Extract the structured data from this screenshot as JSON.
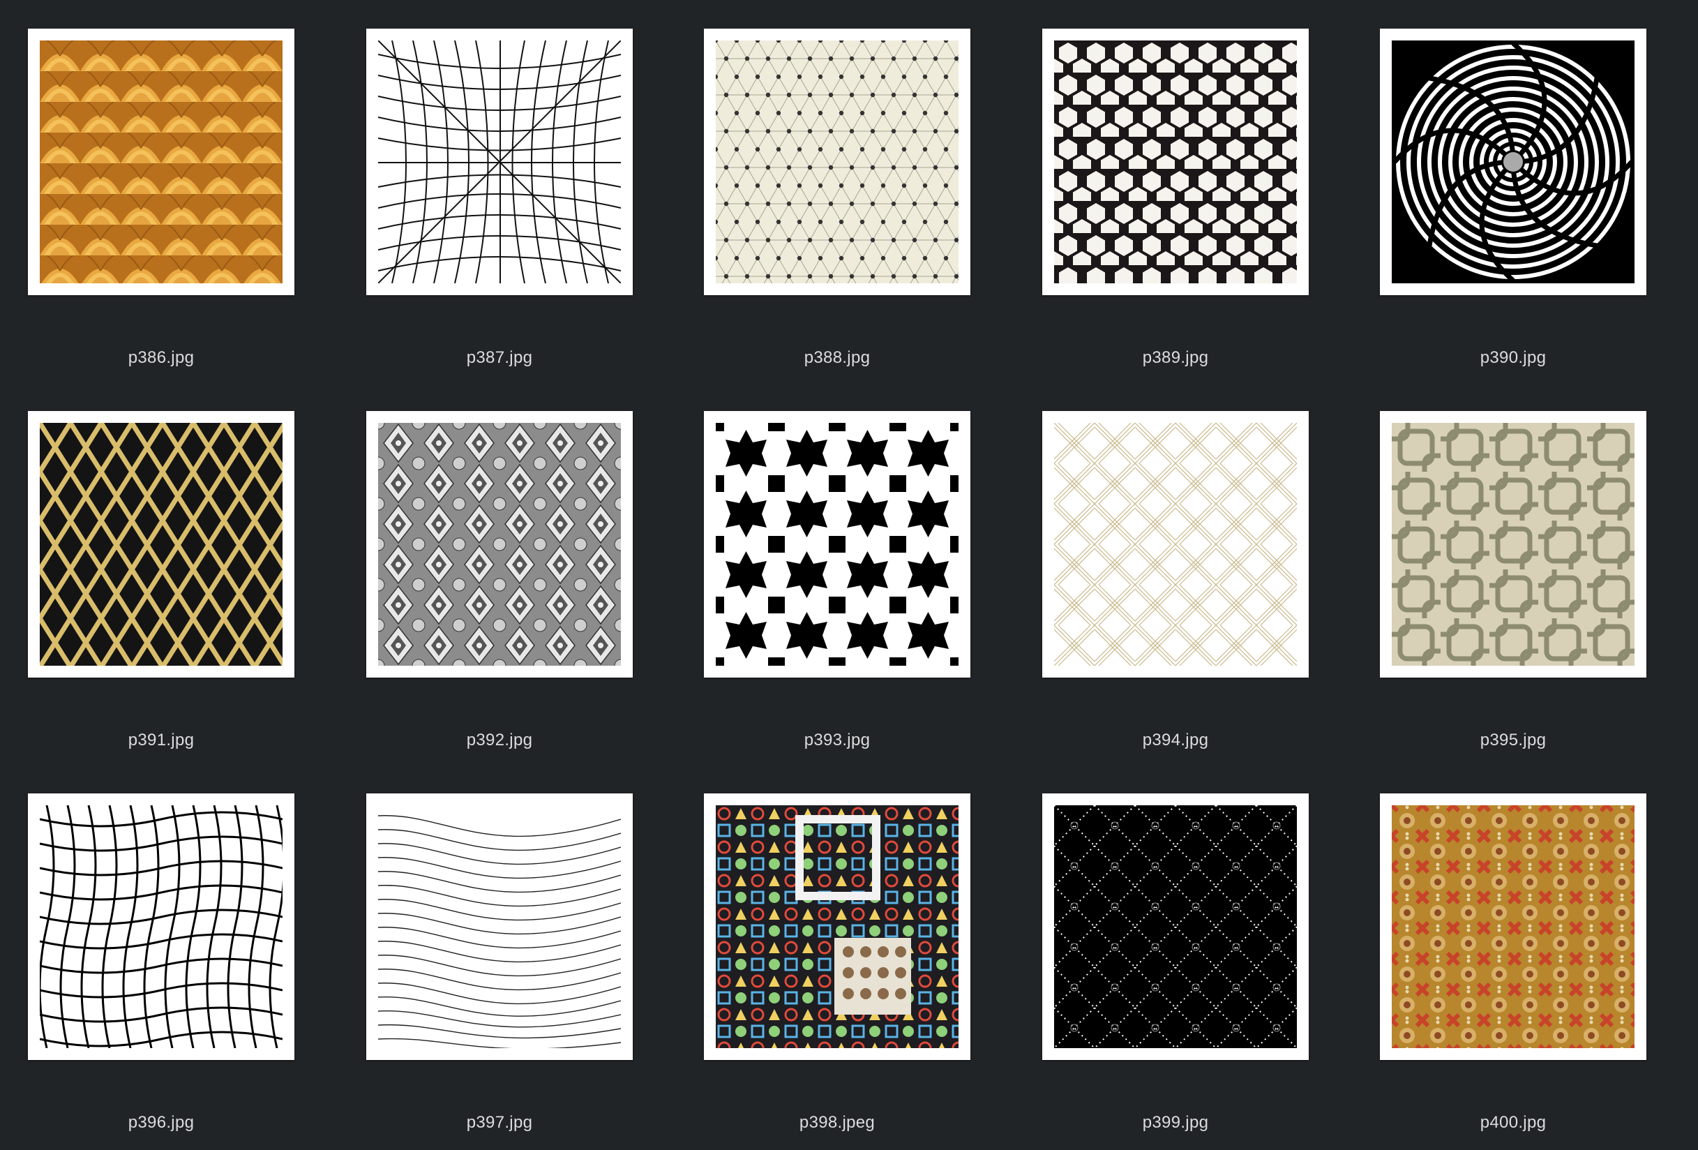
{
  "files": [
    {
      "name": "p386.jpg",
      "thumbnail": "orange-scales-pattern"
    },
    {
      "name": "p387.jpg",
      "thumbnail": "warped-line-grid-pattern"
    },
    {
      "name": "p388.jpg",
      "thumbnail": "beige-geometric-triangle-pattern"
    },
    {
      "name": "p389.jpg",
      "thumbnail": "black-white-hexagon-pattern"
    },
    {
      "name": "p390.jpg",
      "thumbnail": "black-white-spiral-pattern"
    },
    {
      "name": "p391.jpg",
      "thumbnail": "gold-diamond-lattice-pattern"
    },
    {
      "name": "p392.jpg",
      "thumbnail": "grey-ornamental-pattern"
    },
    {
      "name": "p393.jpg",
      "thumbnail": "black-white-star-tile-pattern"
    },
    {
      "name": "p394.jpg",
      "thumbnail": "thin-gold-line-lattice-pattern"
    },
    {
      "name": "p395.jpg",
      "thumbnail": "interlaced-chain-pattern"
    },
    {
      "name": "p396.jpg",
      "thumbnail": "wavy-black-grid-pattern"
    },
    {
      "name": "p397.jpg",
      "thumbnail": "flowing-wave-lines-pattern"
    },
    {
      "name": "p398.jpeg",
      "thumbnail": "colorful-op-art-mosaic"
    },
    {
      "name": "p399.jpg",
      "thumbnail": "black-dotted-diamond-pattern"
    },
    {
      "name": "p400.jpg",
      "thumbnail": "red-gold-floral-pattern"
    }
  ],
  "colors": {
    "background": "#212427",
    "label_text": "#dcdcdc",
    "frame": "#ffffff"
  }
}
